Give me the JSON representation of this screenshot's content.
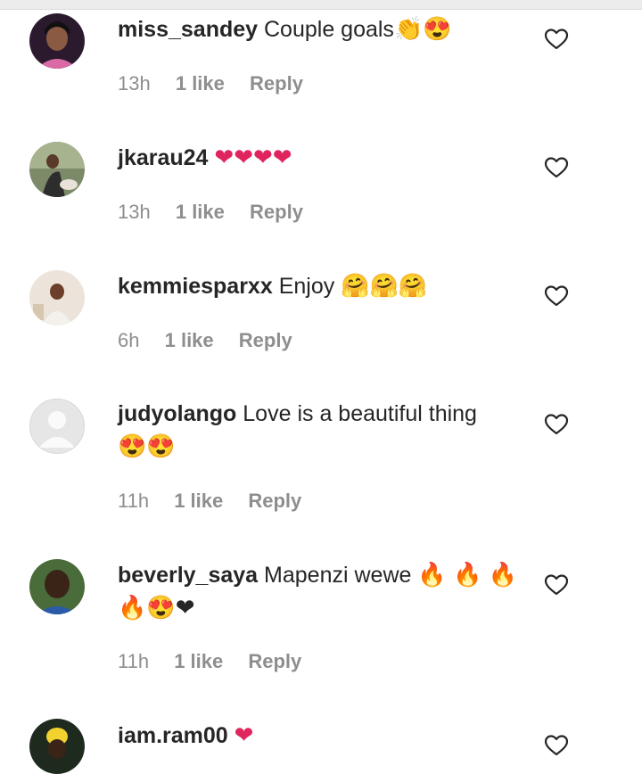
{
  "comments": [
    {
      "username": "miss_sandey",
      "text": "Couple goals",
      "emojis": "👏😍",
      "time": "13h",
      "likes": "1 like",
      "reply": "Reply"
    },
    {
      "username": "jkarau24",
      "text": "",
      "emojis": "❤❤❤❤",
      "time": "13h",
      "likes": "1 like",
      "reply": "Reply"
    },
    {
      "username": "kemmiesparxx",
      "text": "Enjoy",
      "emojis": "🤗🤗🤗",
      "time": "6h",
      "likes": "1 like",
      "reply": "Reply"
    },
    {
      "username": "judyolango",
      "text": "Love is a beautiful thing",
      "emojis": "😍😍",
      "time": "11h",
      "likes": "1 like",
      "reply": "Reply"
    },
    {
      "username": "beverly_saya",
      "text": "Mapenzi wewe",
      "emojis": "🔥 🔥 🔥 🔥😍❤",
      "time": "11h",
      "likes": "1 like",
      "reply": "Reply"
    },
    {
      "username": "iam.ram00",
      "text": "",
      "emojis": "❤",
      "time": "",
      "likes": "",
      "reply": ""
    }
  ]
}
